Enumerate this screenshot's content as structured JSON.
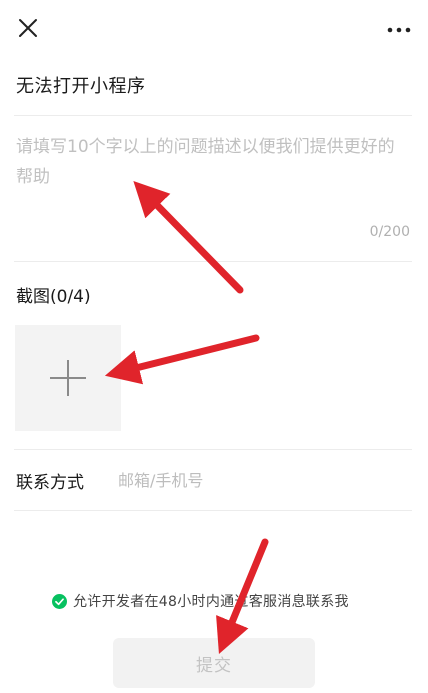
{
  "topbar": {
    "close_icon": "close-icon",
    "more_icon": "more-icon"
  },
  "form": {
    "title": "无法打开小程序",
    "description": {
      "value": "",
      "placeholder": "请填写10个字以上的问题描述以便我们提供更好的帮助",
      "counter": "0/200"
    },
    "screenshot": {
      "label": "截图(0/4)",
      "add_icon": "plus-icon"
    },
    "contact": {
      "label": "联系方式",
      "value": "",
      "placeholder": "邮箱/手机号"
    },
    "consent": {
      "checked": true,
      "text": "允许开发者在48小时内通过客服消息联系我"
    },
    "submit_label": "提交"
  },
  "colors": {
    "accent_green": "#07c160",
    "annotation_red": "#e0242b",
    "disabled_button_bg": "#f2f2f2",
    "disabled_button_text": "#c3c3c3",
    "placeholder_text": "#c0c0c0"
  }
}
